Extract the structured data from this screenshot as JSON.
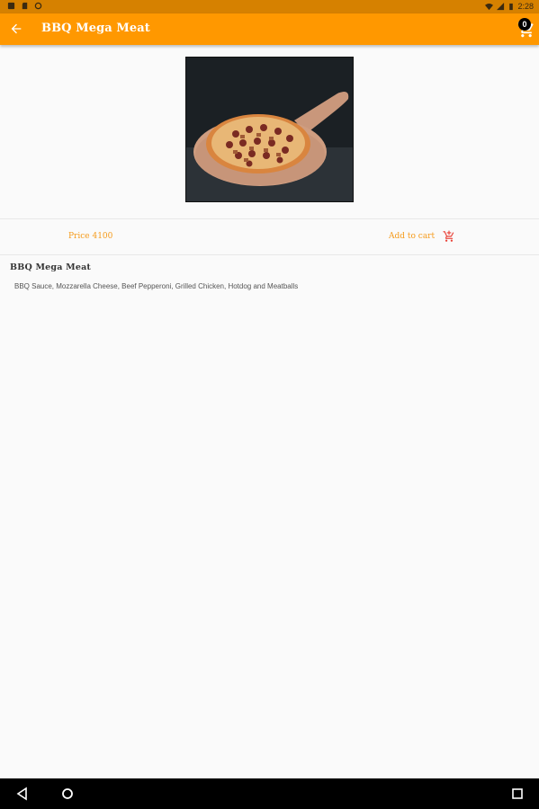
{
  "status_bar": {
    "time": "2:28",
    "icons": [
      "notification-icon",
      "sd-card-icon",
      "sync-icon",
      "wifi-icon",
      "signal-icon",
      "battery-icon"
    ]
  },
  "app_bar": {
    "title": "BBQ Mega Meat",
    "cart_count": "0",
    "back_icon": "arrow-back-icon",
    "cart_icon": "shopping-cart-icon",
    "color": "#ff9800"
  },
  "product": {
    "image": "pizza-image",
    "price_label": "Price 4100",
    "add_to_cart_label": "Add to cart",
    "name": "BBQ Mega Meat",
    "description": "BBQ Sauce, Mozzarella Cheese, Beef Pepperoni, Grilled Chicken, Hotdog and Meatballs",
    "accent_color": "#f59b1c"
  },
  "nav_bar": {
    "icons": [
      "back-triangle-icon",
      "home-circle-icon",
      "recents-square-icon"
    ]
  }
}
